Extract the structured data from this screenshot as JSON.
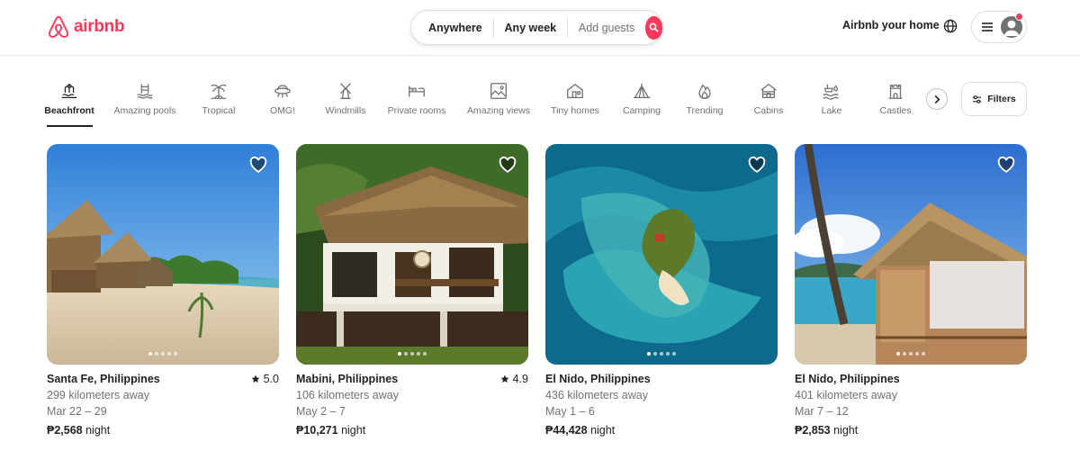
{
  "header": {
    "logo_text": "airbnb",
    "search": {
      "anywhere": "Anywhere",
      "any_week": "Any week",
      "add_guests": "Add guests"
    },
    "host_link": "Airbnb your home"
  },
  "categories": [
    {
      "label": "Beachfront",
      "icon": "beachfront-icon",
      "active": true
    },
    {
      "label": "Amazing pools",
      "icon": "pool-icon"
    },
    {
      "label": "Tropical",
      "icon": "palm-tree-icon"
    },
    {
      "label": "OMG!",
      "icon": "ufo-house-icon"
    },
    {
      "label": "Windmills",
      "icon": "windmill-icon"
    },
    {
      "label": "Private rooms",
      "icon": "bed-icon"
    },
    {
      "label": "Amazing views",
      "icon": "picture-frame-icon"
    },
    {
      "label": "Tiny homes",
      "icon": "tiny-home-icon"
    },
    {
      "label": "Camping",
      "icon": "tent-icon"
    },
    {
      "label": "Trending",
      "icon": "flame-icon"
    },
    {
      "label": "Cabins",
      "icon": "cabin-icon"
    },
    {
      "label": "Lake",
      "icon": "lake-icon"
    },
    {
      "label": "Castles",
      "icon": "castle-icon"
    }
  ],
  "filters_label": "Filters",
  "listings": [
    {
      "location": "Santa Fe, Philippines",
      "rating": "5.0",
      "distance": "299 kilometers away",
      "dates": "Mar 22 – 29",
      "price": "₱2,568",
      "price_unit": "night"
    },
    {
      "location": "Mabini, Philippines",
      "rating": "4.9",
      "distance": "106 kilometers away",
      "dates": "May 2 – 7",
      "price": "₱10,271",
      "price_unit": "night"
    },
    {
      "location": "El Nido, Philippines",
      "rating": "",
      "distance": "436 kilometers away",
      "dates": "May 1 – 6",
      "price": "₱44,428",
      "price_unit": "night"
    },
    {
      "location": "El Nido, Philippines",
      "rating": "",
      "distance": "401 kilometers away",
      "dates": "Mar 7 – 12",
      "price": "₱2,853",
      "price_unit": "night"
    }
  ],
  "colors": {
    "brand": "#FF385C",
    "text": "#222222",
    "muted": "#717171",
    "border": "#DDDDDD"
  }
}
